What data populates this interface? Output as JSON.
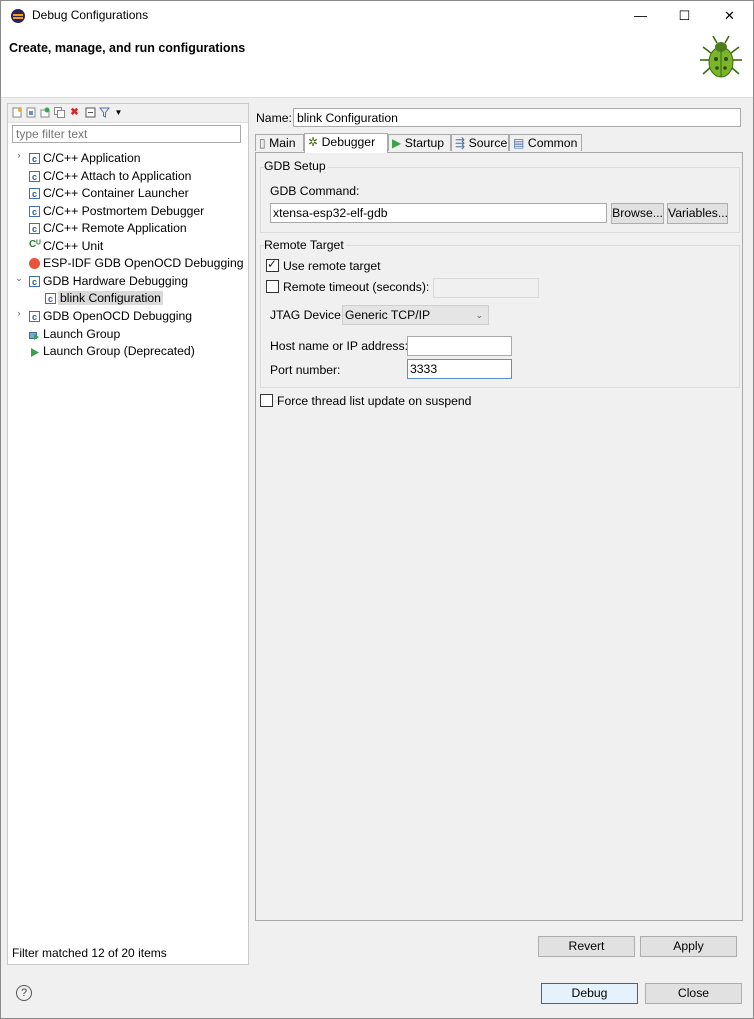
{
  "window": {
    "title": "Debug Configurations",
    "min_glyph": "—",
    "max_glyph": "☐",
    "close_glyph": "✕"
  },
  "header": {
    "title": "Create, manage, and run configurations"
  },
  "left": {
    "filter_placeholder": "type filter text",
    "status": "Filter matched 12 of 20 items",
    "items": [
      {
        "label": "C/C++ Application",
        "chevron": "›"
      },
      {
        "label": "C/C++ Attach to Application"
      },
      {
        "label": "C/C++ Container Launcher"
      },
      {
        "label": "C/C++ Postmortem Debugger"
      },
      {
        "label": "C/C++ Remote Application"
      },
      {
        "label": "C/C++ Unit"
      },
      {
        "label": "ESP-IDF GDB OpenOCD Debugging"
      },
      {
        "label": "GDB Hardware Debugging",
        "chevron": "⌄"
      },
      {
        "label": "blink Configuration"
      },
      {
        "label": "GDB OpenOCD Debugging",
        "chevron": "›"
      },
      {
        "label": "Launch Group"
      },
      {
        "label": "Launch Group (Deprecated)"
      }
    ]
  },
  "right": {
    "name_label": "Name:",
    "name_value": "blink Configuration",
    "tabs": [
      {
        "label": "Main"
      },
      {
        "label": "Debugger"
      },
      {
        "label": "Startup"
      },
      {
        "label": "Source"
      },
      {
        "label": "Common"
      }
    ],
    "gdb_setup": {
      "group_label": "GDB Setup",
      "command_label": "GDB Command:",
      "command_value": "xtensa-esp32-elf-gdb",
      "browse_label": "Browse...",
      "variables_label": "Variables..."
    },
    "remote_target": {
      "group_label": "Remote Target",
      "use_remote_label": "Use remote target",
      "use_remote_checked": true,
      "timeout_label": "Remote timeout (seconds):",
      "timeout_checked": false,
      "jtag_label": "JTAG Device:",
      "jtag_value": "Generic TCP/IP",
      "host_label": "Host name or IP address:",
      "host_value": "",
      "port_label": "Port number:",
      "port_value": "3333"
    },
    "force_thread_label": "Force thread list update on suspend",
    "force_thread_checked": false,
    "revert_label": "Revert",
    "apply_label": "Apply"
  },
  "footer": {
    "help_glyph": "?",
    "debug_label": "Debug",
    "close_label": "Close"
  }
}
